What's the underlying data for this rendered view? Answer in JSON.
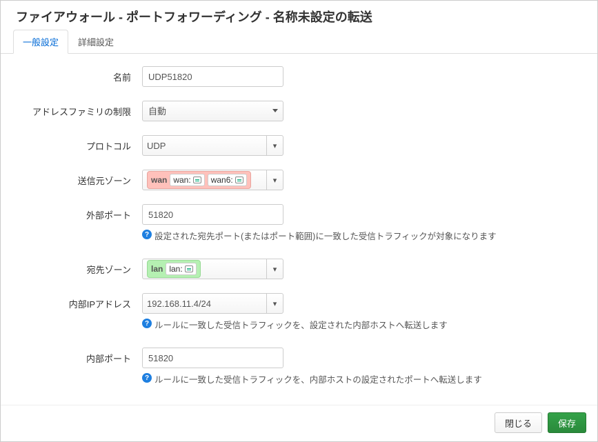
{
  "header": {
    "title": "ファイアウォール - ポートフォワーディング - 名称未設定の転送"
  },
  "tabs": {
    "items": [
      {
        "label": "一般設定",
        "active": true
      },
      {
        "label": "詳細設定",
        "active": false
      }
    ]
  },
  "fields": {
    "name": {
      "label": "名前",
      "value": "UDP51820"
    },
    "af": {
      "label": "アドレスファミリの制限",
      "value": "自動"
    },
    "proto": {
      "label": "プロトコル",
      "value": "UDP"
    },
    "srczone": {
      "label": "送信元ゾーン",
      "zone_name": "wan",
      "sub1": "wan:",
      "sub2": "wan6:"
    },
    "extport": {
      "label": "外部ポート",
      "value": "51820",
      "help": "設定された宛先ポート(またはポート範囲)に一致した受信トラフィックが対象になります"
    },
    "dstzone": {
      "label": "宛先ゾーン",
      "zone_name": "lan",
      "sub1": "lan:"
    },
    "intip": {
      "label": "内部IPアドレス",
      "value": "192.168.11.4/24",
      "help": "ルールに一致した受信トラフィックを、設定された内部ホストへ転送します"
    },
    "intport": {
      "label": "内部ポート",
      "value": "51820",
      "help": "ルールに一致した受信トラフィックを、内部ホストの設定されたポートへ転送します"
    }
  },
  "footer": {
    "close": "閉じる",
    "save": "保存"
  },
  "help_glyph": "?"
}
